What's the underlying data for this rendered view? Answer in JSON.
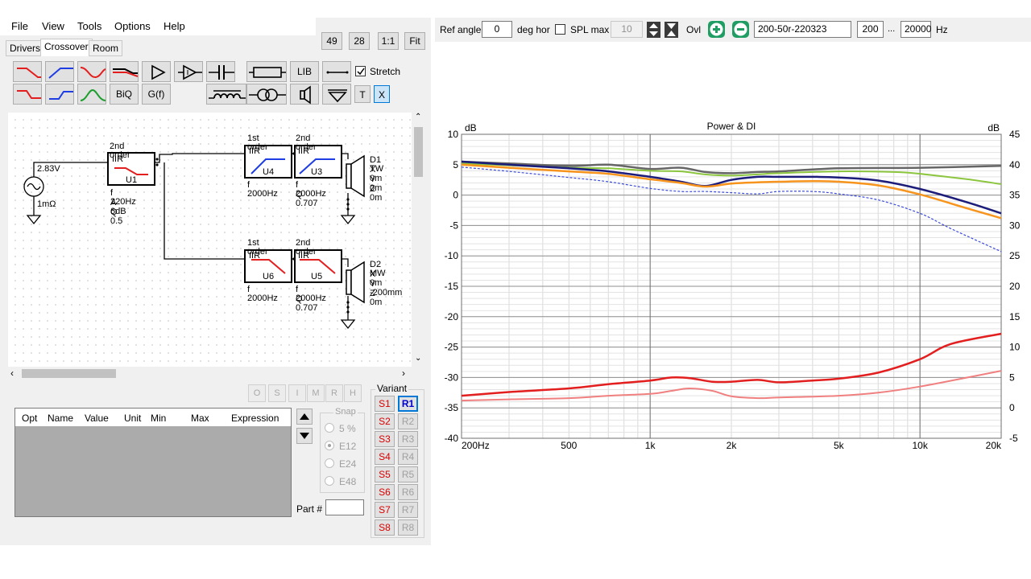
{
  "menu": {
    "file": "File",
    "view": "View",
    "tools": "Tools",
    "options": "Options",
    "help": "Help"
  },
  "tabs": {
    "drivers": "Drivers",
    "crossover": "Crossover",
    "room": "Room"
  },
  "zoom": {
    "b49": "49",
    "b28": "28",
    "one_to_one": "1:1",
    "fit": "Fit"
  },
  "tools": {
    "lib": "LIB",
    "biq": "BiQ",
    "gf": "G(f)",
    "t": "T",
    "x": "X",
    "stretch": "Stretch"
  },
  "schematic": {
    "source_voltage": "2.83V",
    "source_resistance": "1mΩ",
    "u1": {
      "order": "2nd order",
      "type": "IIR",
      "name": "U1",
      "f": "f  220Hz",
      "a": "A  6dB",
      "q": "Q  0.5"
    },
    "u4": {
      "order": "1st order",
      "type": "IIR",
      "name": "U4",
      "f": "f  2000Hz"
    },
    "u3": {
      "order": "2nd order",
      "type": "IIR",
      "name": "U3",
      "f": "f  2000Hz",
      "q": "Q  0.707"
    },
    "u6": {
      "order": "1st order",
      "type": "IIR",
      "name": "U6",
      "f": "f  2000Hz"
    },
    "u5": {
      "order": "2nd order",
      "type": "IIR",
      "name": "U5",
      "f": "f  2000Hz",
      "q": "Q  0.707"
    },
    "d1": {
      "name": "D1 TW",
      "x": "X 0m",
      "y": "Y 0m",
      "z": "Z 0m"
    },
    "d2": {
      "name": "D2 MW",
      "x": "X 0m",
      "y": "Y -200mm",
      "z": "Z 0m"
    }
  },
  "greybuttons": [
    "O",
    "S",
    "I",
    "M",
    "R",
    "H"
  ],
  "params_table": {
    "columns": [
      "Opt",
      "Name",
      "Value",
      "Unit",
      "Min",
      "Max",
      "Expression"
    ]
  },
  "snap": {
    "title": "Snap",
    "options": [
      "5 %",
      "E12",
      "E24",
      "E48"
    ],
    "selected": "E12"
  },
  "part_label": "Part #",
  "variant": {
    "title": "Variant",
    "s": [
      "S1",
      "S2",
      "S3",
      "S4",
      "S5",
      "S6",
      "S7",
      "S8"
    ],
    "r": [
      "R1",
      "R2",
      "R3",
      "R4",
      "R5",
      "R6",
      "R7",
      "R8"
    ],
    "selected": "R1"
  },
  "toolbar": {
    "ref_angle_label": "Ref angle",
    "ref_angle_value": "0",
    "deg_hor": "deg hor",
    "spl_max": "SPL max",
    "spl_max_value": "10",
    "ovl": "Ovl",
    "variant_name": "200-50r-220323",
    "f_min": "200",
    "ellipsis": "...",
    "f_max": "20000",
    "hz": "Hz"
  },
  "chart_data": {
    "type": "line",
    "title": "Power & DI",
    "xlabel": "",
    "ylabel": "dB",
    "y2label": "dB",
    "x_scale": "log",
    "xlim": [
      200,
      20000
    ],
    "ylim": [
      -40,
      10
    ],
    "y2lim": [
      -5,
      45
    ],
    "x_ticks": [
      {
        "v": 200,
        "label": "200Hz"
      },
      {
        "v": 500,
        "label": "500"
      },
      {
        "v": 1000,
        "label": "1k"
      },
      {
        "v": 2000,
        "label": "2k"
      },
      {
        "v": 5000,
        "label": "5k"
      },
      {
        "v": 10000,
        "label": "10k"
      },
      {
        "v": 20000,
        "label": "20k"
      }
    ],
    "y_ticks": [
      10,
      5,
      0,
      -5,
      -10,
      -15,
      -20,
      -25,
      -30,
      -35,
      -40
    ],
    "y2_ticks": [
      45,
      40,
      35,
      30,
      25,
      20,
      15,
      10,
      5,
      0,
      -5
    ],
    "grid": true,
    "series": [
      {
        "color": "#666666",
        "width": 2.5,
        "dash": "",
        "axis": "y2",
        "x": [
          200,
          300,
          500,
          700,
          1000,
          1300,
          1600,
          2000,
          2500,
          3000,
          5000,
          10000,
          20000
        ],
        "y": [
          40.5,
          40.2,
          39.8,
          40.0,
          39.3,
          39.5,
          38.8,
          38.6,
          38.8,
          38.9,
          39.4,
          39.5,
          39.8
        ]
      },
      {
        "color": "#8cc63f",
        "width": 2,
        "dash": "",
        "axis": "y2",
        "x": [
          200,
          300,
          500,
          700,
          1000,
          1300,
          1600,
          2000,
          2500,
          3000,
          5000,
          8000,
          10000,
          15000,
          20000
        ],
        "y": [
          40.2,
          39.9,
          39.5,
          39.4,
          39.0,
          38.9,
          38.4,
          38.2,
          38.4,
          38.6,
          38.9,
          38.8,
          38.5,
          37.6,
          36.8
        ]
      },
      {
        "color": "#1c1c7a",
        "width": 2.5,
        "dash": "",
        "axis": "y",
        "x": [
          200,
          300,
          500,
          700,
          1000,
          1300,
          1600,
          2000,
          2500,
          3000,
          4000,
          5000,
          7000,
          10000,
          15000,
          20000
        ],
        "y": [
          5.5,
          5.0,
          4.4,
          3.9,
          3.0,
          2.2,
          1.5,
          2.5,
          3.0,
          3.0,
          3.0,
          2.9,
          2.4,
          1.0,
          -1.2,
          -3.0
        ]
      },
      {
        "color": "#f7941d",
        "width": 2.5,
        "dash": "",
        "axis": "y",
        "x": [
          200,
          300,
          500,
          700,
          1000,
          1300,
          1600,
          2000,
          2500,
          3000,
          4000,
          5000,
          7000,
          10000,
          15000,
          20000
        ],
        "y": [
          5.0,
          4.5,
          3.9,
          3.5,
          2.6,
          2.0,
          1.4,
          1.9,
          2.1,
          2.2,
          2.3,
          2.2,
          1.6,
          0.1,
          -2.2,
          -3.8
        ]
      },
      {
        "color": "#3b4bd9",
        "width": 1.2,
        "dash": "3,2",
        "axis": "y",
        "x": [
          200,
          300,
          500,
          700,
          1000,
          1300,
          1600,
          2000,
          2500,
          3000,
          4000,
          5000,
          7000,
          10000,
          13000,
          20000
        ],
        "y": [
          4.6,
          3.9,
          2.9,
          2.2,
          1.1,
          0.6,
          0.6,
          0.4,
          0.2,
          0.6,
          0.6,
          0.2,
          -0.8,
          -3.0,
          -5.5,
          -9.3
        ]
      },
      {
        "color": "#e31e1e",
        "width": 2.5,
        "dash": "",
        "axis": "y",
        "x": [
          200,
          300,
          500,
          700,
          1000,
          1200,
          1400,
          1700,
          2000,
          2500,
          3000,
          4000,
          5000,
          7000,
          10000,
          13000,
          20000
        ],
        "y": [
          -33.0,
          -32.4,
          -31.8,
          -31.1,
          -30.5,
          -30.0,
          -30.1,
          -30.7,
          -30.7,
          -30.4,
          -30.8,
          -30.5,
          -30.2,
          -29.2,
          -27.0,
          -24.5,
          -22.8
        ]
      },
      {
        "color": "#f08080",
        "width": 2,
        "dash": "",
        "axis": "y",
        "x": [
          200,
          300,
          500,
          700,
          1000,
          1200,
          1400,
          1700,
          2000,
          2500,
          3000,
          5000,
          7000,
          10000,
          15000,
          20000
        ],
        "y": [
          -33.8,
          -33.6,
          -33.4,
          -33.0,
          -32.7,
          -32.2,
          -31.8,
          -32.2,
          -33.1,
          -33.4,
          -33.3,
          -33.0,
          -32.5,
          -31.5,
          -30.0,
          -28.9
        ]
      }
    ]
  },
  "colors": {
    "accent_blue": "#0078d7",
    "variant_red": "#d90000",
    "chart_grid": "#c8c8c8"
  }
}
